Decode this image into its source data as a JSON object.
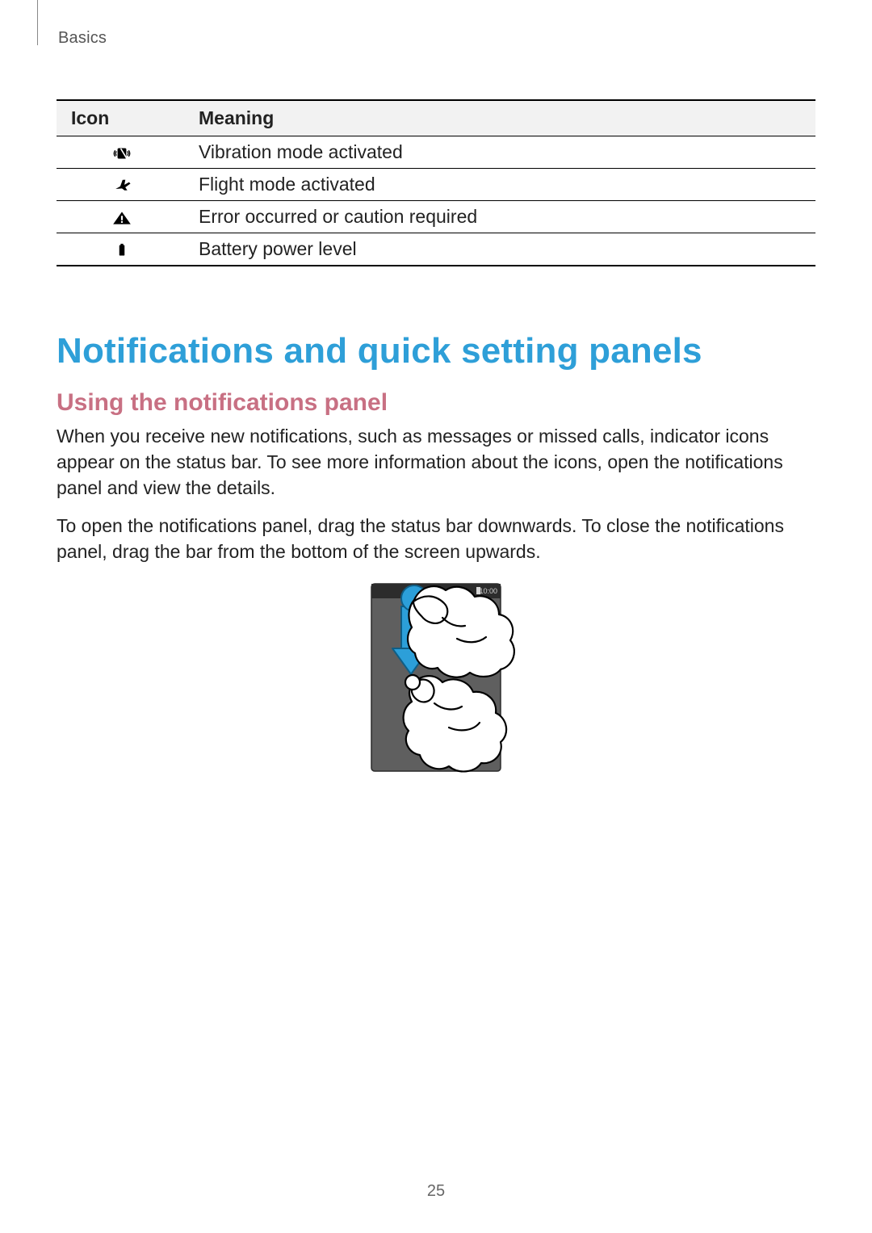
{
  "header": {
    "section": "Basics"
  },
  "table": {
    "headers": {
      "icon": "Icon",
      "meaning": "Meaning"
    },
    "rows": [
      {
        "icon_name": "vibration-icon",
        "meaning": "Vibration mode activated"
      },
      {
        "icon_name": "flight-icon",
        "meaning": "Flight mode activated"
      },
      {
        "icon_name": "warning-icon",
        "meaning": "Error occurred or caution required"
      },
      {
        "icon_name": "battery-icon",
        "meaning": "Battery power level"
      }
    ]
  },
  "headings": {
    "major": "Notifications and quick setting panels",
    "sub": "Using the notifications panel"
  },
  "paragraphs": {
    "p1": "When you receive new notifications, such as messages or missed calls, indicator icons appear on the status bar. To see more information about the icons, open the notifications panel and view the details.",
    "p2": "To open the notifications panel, drag the status bar downwards. To close the notifications panel, drag the bar from the bottom of the screen upwards."
  },
  "illustration": {
    "status_time": "10:00"
  },
  "page_number": "25",
  "colors": {
    "major_heading": "#2e9fd8",
    "sub_heading": "#c87083",
    "arrow_fill": "#2c9fd9",
    "arrow_stroke": "#0f5e86"
  }
}
